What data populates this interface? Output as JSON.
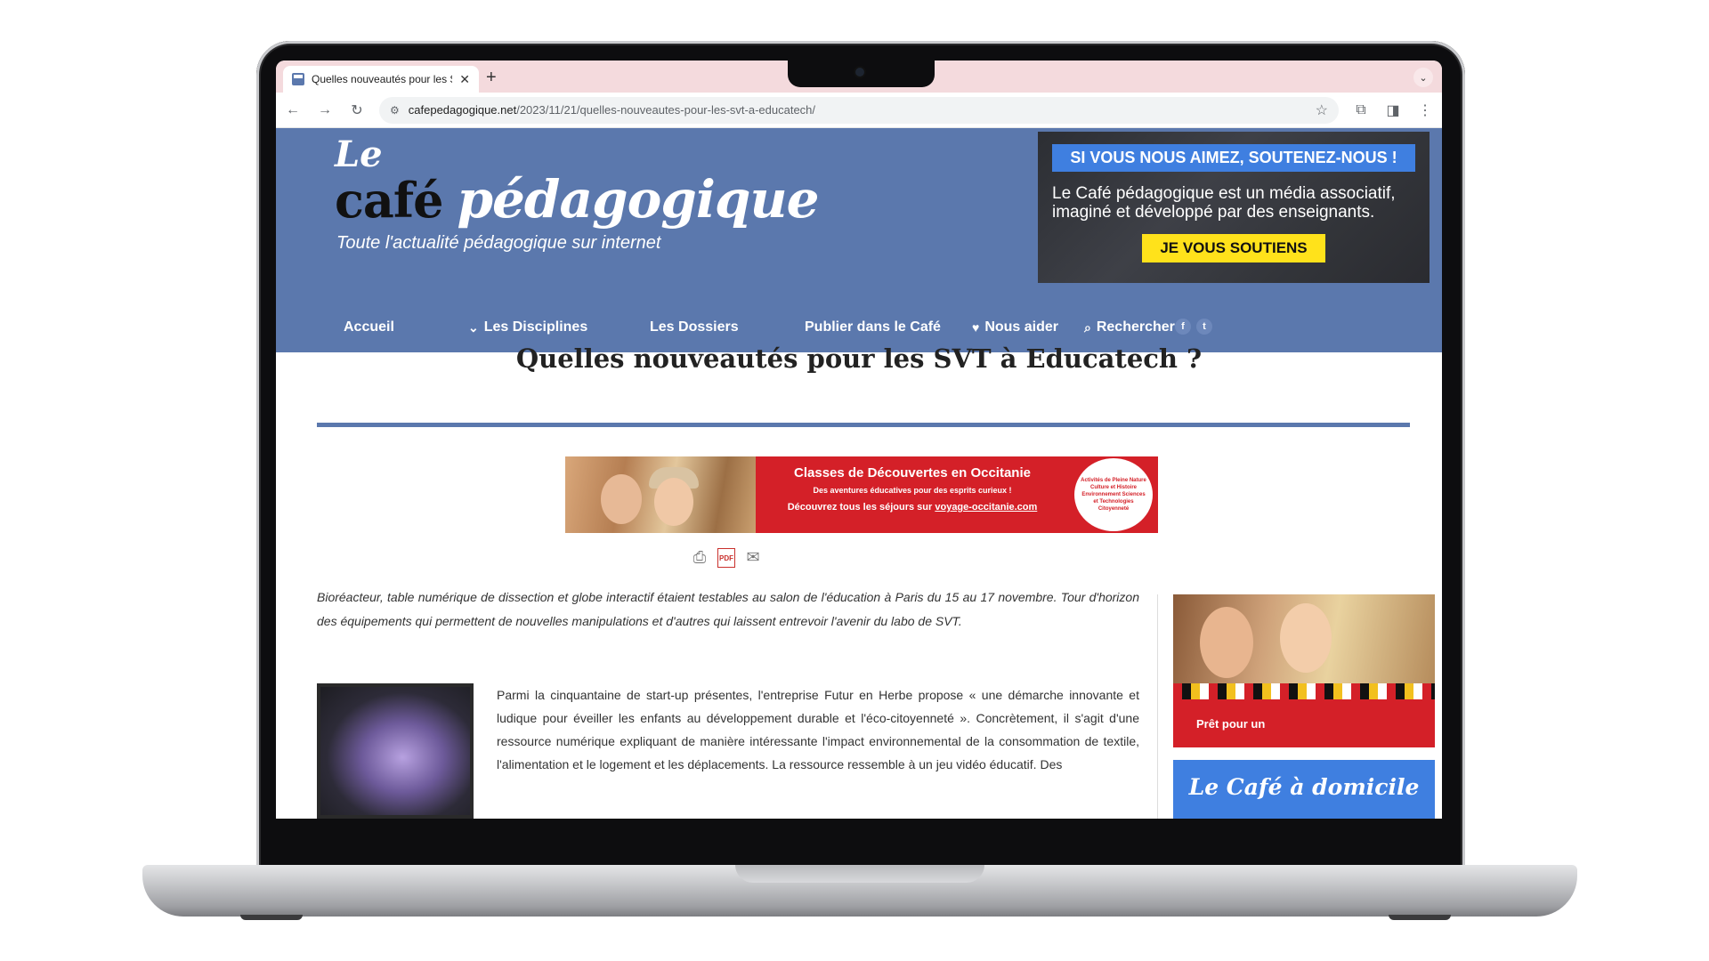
{
  "browser": {
    "tab_title": "Quelles nouveautés pour les SVT",
    "new_tab_label": "+",
    "url_host": "cafepedagogique.net",
    "url_path": "/2023/11/21/quelles-nouveautes-pour-les-svt-a-educatech/"
  },
  "site": {
    "logo_le": "Le",
    "logo_cafe": "café",
    "logo_pedagogique": "pédagogique",
    "tagline": "Toute l'actualité pédagogique sur internet"
  },
  "support": {
    "title": "SI VOUS NOUS AIMEZ, SOUTENEZ-NOUS !",
    "text": "Le Café pédagogique est un média associatif, imaginé et développé par des enseignants.",
    "button": "JE VOUS SOUTIENS"
  },
  "nav": {
    "accueil": "Accueil",
    "disciplines": "Les Disciplines",
    "dossiers": "Les Dossiers",
    "publier": "Publier dans le Café",
    "nous_aider": "Nous aider",
    "rechercher": "Rechercher",
    "facebook": "f",
    "twitter": "t"
  },
  "article": {
    "title": "Quelles nouveautés pour les SVT à Educatech ?",
    "intro": "Bioréacteur, table numérique de dissection et globe interactif étaient testables au salon de l'éducation à Paris du 15 au 17 novembre. Tour d'horizon des équipements qui permettent de nouvelles manipulations et d'autres qui laissent entrevoir l'avenir du labo de SVT.",
    "body": "Parmi la cinquantaine de start-up présentes, l'entreprise Futur en Herbe propose « une démarche innovante et ludique pour éveiller les enfants au développement durable et l'éco-citoyenneté ». Concrètement, il s'agit d'une ressource numérique expliquant de manière intéressante l'impact environnemental de la consommation de textile, l'alimentation et le logement et les déplacements. La ressource ressemble à un jeu vidéo éducatif. Des"
  },
  "ad_banner": {
    "title": "Classes de Découvertes en Occitanie",
    "subtitle": "Des aventures éducatives pour des esprits curieux !",
    "cta_prefix": "Découvrez tous les séjours sur ",
    "cta_link": "voyage-occitanie.com",
    "badge": "Activités de Pleine Nature Culture et Histoire Environnement Sciences et Technologies Citoyenneté"
  },
  "tools": {
    "pdf": "PDF"
  },
  "sidebar": {
    "ad1_text": "Prêt pour un",
    "ad2_text": "Le Café à domicile"
  },
  "colors": {
    "brand_blue": "#5b78ad",
    "support_blue": "#3f7fe0",
    "cta_yellow": "#ffe21b",
    "ad_red": "#d42028"
  }
}
